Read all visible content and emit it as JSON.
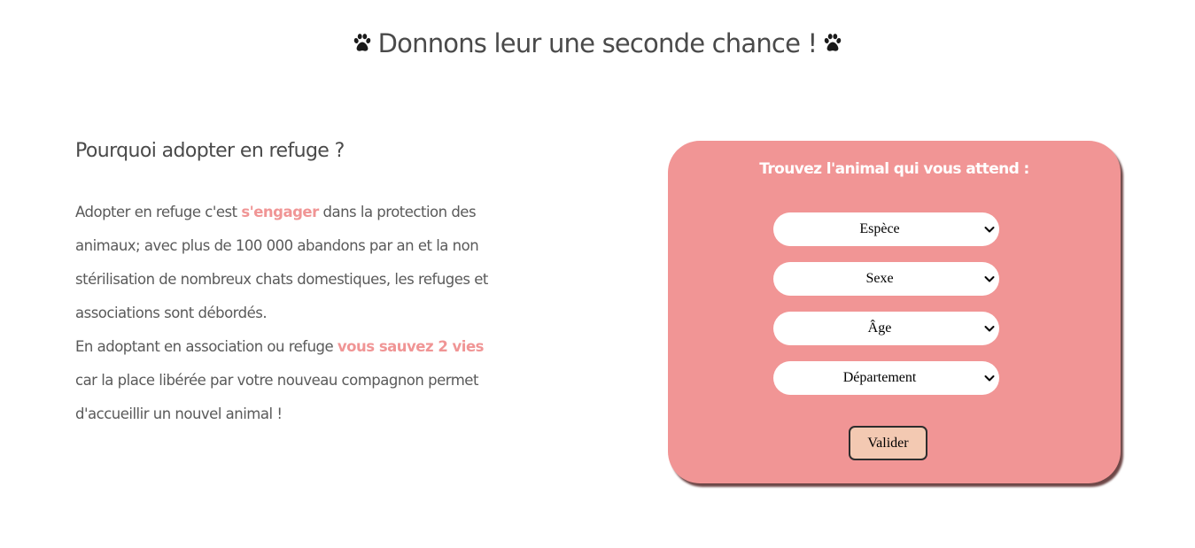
{
  "header": {
    "title": "Donnons leur une seconde chance !"
  },
  "intro": {
    "heading": "Pourquoi adopter en refuge ?",
    "paragraph1": {
      "before": "Adopter en refuge c'est ",
      "highlight": "s'engager",
      "after": " dans la protection des animaux; avec plus de 100 000 abandons par an et la non stérilisation de nombreux chats domestiques, les refuges et associations sont débordés."
    },
    "paragraph2": {
      "before": "En adoptant en association ou refuge ",
      "highlight": "vous sauvez 2 vies",
      "after": " car la place libérée par votre nouveau compagnon permet d'accueillir un nouvel animal !"
    }
  },
  "search_form": {
    "heading": "Trouvez l'animal qui vous attend :",
    "species_select": {
      "value": "Espèce"
    },
    "sex_select": {
      "value": "Sexe"
    },
    "age_select": {
      "value": "Âge"
    },
    "department_select": {
      "value": "Département"
    },
    "submit_label": "Valider"
  },
  "colors": {
    "accent": "#f09595",
    "card_background": "#f19595",
    "button_background": "#f3c9b2",
    "text": "#4a4a4a"
  },
  "icons": {
    "title_left": "paw-icon",
    "title_right": "paw-icon",
    "select_arrow": "chevron-down-icon"
  }
}
